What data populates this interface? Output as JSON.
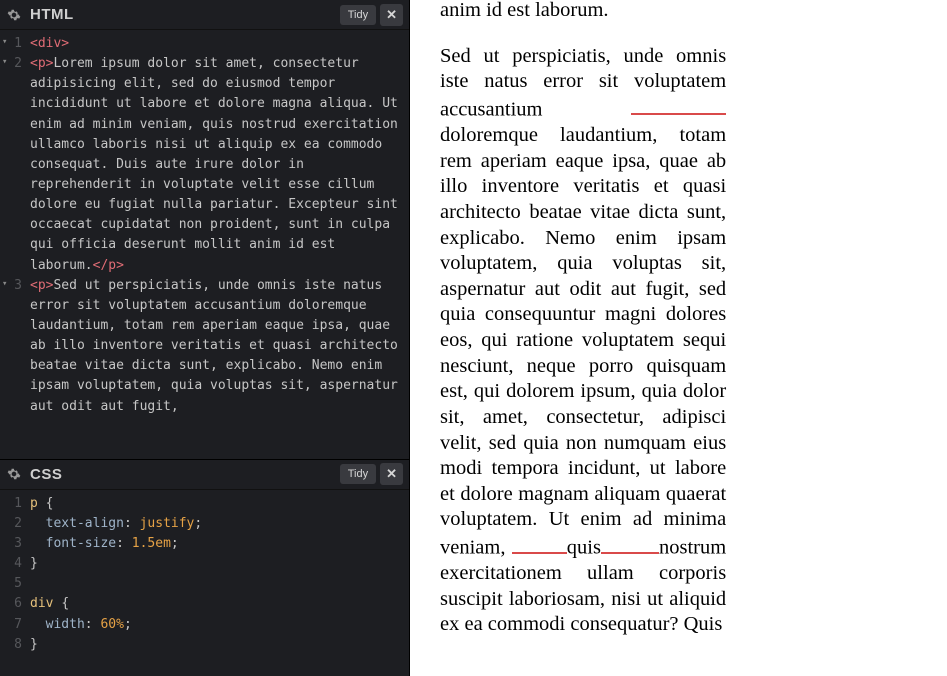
{
  "panels": {
    "html": {
      "title": "HTML",
      "tidy_label": "Tidy",
      "close_label": "✕",
      "code": {
        "lines": [
          {
            "n": "1",
            "fold": true,
            "tokens": [
              [
                "tag",
                "<div>"
              ]
            ]
          },
          {
            "n": "2",
            "fold": true,
            "tokens": [
              [
                "tag",
                "<p>"
              ],
              [
                "text",
                "Lorem ipsum dolor sit amet, consectetur adipisicing elit, sed do eiusmod tempor incididunt ut labore et dolore magna aliqua. Ut enim ad minim veniam, quis nostrud exercitation ullamco laboris nisi ut aliquip ex ea commodo consequat. Duis aute irure dolor in reprehenderit in voluptate velit esse cillum dolore eu fugiat nulla pariatur. Excepteur sint occaecat cupidatat non proident, sunt in culpa qui officia deserunt mollit anim id est laborum."
              ],
              [
                "tag",
                "</p>"
              ]
            ]
          },
          {
            "n": "3",
            "fold": true,
            "tokens": [
              [
                "tag",
                "<p>"
              ],
              [
                "text",
                "Sed ut perspiciatis, unde omnis iste natus error sit voluptatem accusantium doloremque laudantium, totam rem aperiam eaque ipsa, quae ab illo inventore veritatis et quasi architecto beatae vitae dicta sunt, explicabo. Nemo enim ipsam voluptatem, quia voluptas sit, aspernatur aut odit aut fugit,"
              ]
            ]
          }
        ]
      }
    },
    "css": {
      "title": "CSS",
      "tidy_label": "Tidy",
      "close_label": "✕",
      "code": {
        "lines": [
          {
            "n": "1",
            "fold": false,
            "tokens": [
              [
                "sel",
                "p "
              ],
              [
                "punc",
                "{"
              ]
            ]
          },
          {
            "n": "2",
            "fold": false,
            "tokens": [
              [
                "text",
                "  "
              ],
              [
                "prop",
                "text-align"
              ],
              [
                "punc",
                ": "
              ],
              [
                "val",
                "justify"
              ],
              [
                "punc",
                ";"
              ]
            ]
          },
          {
            "n": "3",
            "fold": false,
            "tokens": [
              [
                "text",
                "  "
              ],
              [
                "prop",
                "font-size"
              ],
              [
                "punc",
                ": "
              ],
              [
                "val",
                "1.5em"
              ],
              [
                "punc",
                ";"
              ]
            ]
          },
          {
            "n": "4",
            "fold": false,
            "tokens": [
              [
                "punc",
                "}"
              ]
            ]
          },
          {
            "n": "5",
            "fold": false,
            "tokens": [
              [
                "text",
                ""
              ]
            ]
          },
          {
            "n": "6",
            "fold": false,
            "tokens": [
              [
                "sel",
                "div "
              ],
              [
                "punc",
                "{"
              ]
            ]
          },
          {
            "n": "7",
            "fold": false,
            "tokens": [
              [
                "text",
                "  "
              ],
              [
                "prop",
                "width"
              ],
              [
                "punc",
                ": "
              ],
              [
                "val",
                "60%"
              ],
              [
                "punc",
                ";"
              ]
            ]
          },
          {
            "n": "8",
            "fold": false,
            "tokens": [
              [
                "punc",
                "}"
              ]
            ]
          }
        ]
      }
    }
  },
  "preview": {
    "p1": "anim id est laborum.",
    "p2a": "Sed ut perspiciatis, unde omnis iste natus error sit voluptatem accusantium",
    "p2b": "doloremque laudantium, totam rem aperiam eaque ipsa, quae ab illo inventore veritatis et quasi architecto beatae vitae dicta sunt, explicabo. Nemo enim ipsam voluptatem, quia voluptas sit, aspernatur aut odit aut fugit, sed quia consequuntur magni dolores eos, qui ratione voluptatem sequi nesciunt, neque porro quisquam est, qui dolorem ipsum, quia dolor sit, amet, consectetur, adipisci velit, sed quia non numquam eius modi tempora incidunt, ut labore et dolore magnam aliquam quaerat voluptatem. Ut enim ad minima veniam,",
    "p2c": "quis",
    "p2d": "nostrum exercitationem ullam corporis suscipit laboriosam, nisi ut aliquid ex ea commodi consequatur? Quis"
  }
}
